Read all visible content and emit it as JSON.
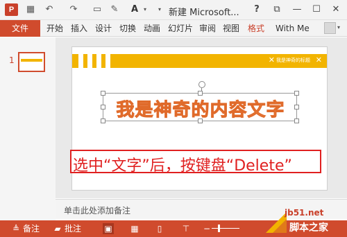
{
  "titlebar": {
    "app_logo": "P",
    "qat_icons": [
      "save-icon",
      "undo-icon",
      "redo-icon",
      "slideshow-icon",
      "format-painter-icon",
      "font-color-icon"
    ],
    "font_color_glyph": "A",
    "title": "新建 Microsoft...",
    "help": "?",
    "ribbon_display": "⧉",
    "minimize": "—",
    "maximize": "☐",
    "close": "✕"
  },
  "ribbon": {
    "file_label": "文件",
    "tabs": [
      "开始",
      "插入",
      "设计",
      "切换",
      "动画",
      "幻灯片",
      "审阅",
      "视图",
      "格式"
    ],
    "user": "With Me"
  },
  "thumbnails": {
    "slide_number": "1",
    "thumb_text": "我是神奇的内容文字"
  },
  "slide": {
    "banner_text": "我是神奇的标题",
    "content_text": "我是神奇的内容文字",
    "callout_text": "选中“文字”后，按键盘“Delete”"
  },
  "notes": {
    "placeholder": "单击此处添加备注"
  },
  "statusbar": {
    "notes_label": "备注",
    "comments_label": "批注"
  },
  "watermark": {
    "site": "jb51.net",
    "name": "脚本之家"
  },
  "colors": {
    "accent": "#d04b2d",
    "banner": "#f2b400",
    "callout": "#e02020",
    "text_fill": "#f7c08a",
    "text_stroke": "#e06a2a"
  }
}
